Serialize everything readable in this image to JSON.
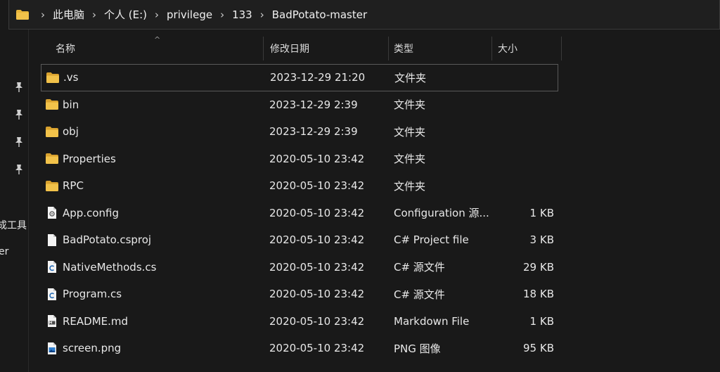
{
  "breadcrumb": [
    "此电脑",
    "个人 (E:)",
    "privilege",
    "133",
    "BadPotato-master"
  ],
  "breadcrumb_separator": "›",
  "nav": {
    "partial_labels": [
      "成工具",
      "er"
    ]
  },
  "columns": {
    "name": "名称",
    "date": "修改日期",
    "type": "类型",
    "size": "大小",
    "sort_indicator": "^"
  },
  "files": [
    {
      "icon": "folder-icon",
      "name": ".vs",
      "date": "2023-12-29 21:20",
      "type": "文件夹",
      "size": ""
    },
    {
      "icon": "folder-icon",
      "name": "bin",
      "date": "2023-12-29 2:39",
      "type": "文件夹",
      "size": ""
    },
    {
      "icon": "folder-icon",
      "name": "obj",
      "date": "2023-12-29 2:39",
      "type": "文件夹",
      "size": ""
    },
    {
      "icon": "folder-icon",
      "name": "Properties",
      "date": "2020-05-10 23:42",
      "type": "文件夹",
      "size": ""
    },
    {
      "icon": "folder-icon",
      "name": "RPC",
      "date": "2020-05-10 23:42",
      "type": "文件夹",
      "size": ""
    },
    {
      "icon": "config-file-icon",
      "name": "App.config",
      "date": "2020-05-10 23:42",
      "type": "Configuration 源...",
      "size": "1 KB"
    },
    {
      "icon": "blank-file-icon",
      "name": "BadPotato.csproj",
      "date": "2020-05-10 23:42",
      "type": "C# Project file",
      "size": "3 KB"
    },
    {
      "icon": "csharp-file-icon",
      "name": "NativeMethods.cs",
      "date": "2020-05-10 23:42",
      "type": "C# 源文件",
      "size": "29 KB"
    },
    {
      "icon": "csharp-file-icon",
      "name": "Program.cs",
      "date": "2020-05-10 23:42",
      "type": "C# 源文件",
      "size": "18 KB"
    },
    {
      "icon": "markdown-file-icon",
      "name": "README.md",
      "date": "2020-05-10 23:42",
      "type": "Markdown File",
      "size": "1 KB"
    },
    {
      "icon": "image-file-icon",
      "name": "screen.png",
      "date": "2020-05-10 23:42",
      "type": "PNG 图像",
      "size": "95 KB"
    }
  ],
  "colors": {
    "background": "#191919",
    "folder": "#e8b53a",
    "text": "#e8e8e8"
  }
}
